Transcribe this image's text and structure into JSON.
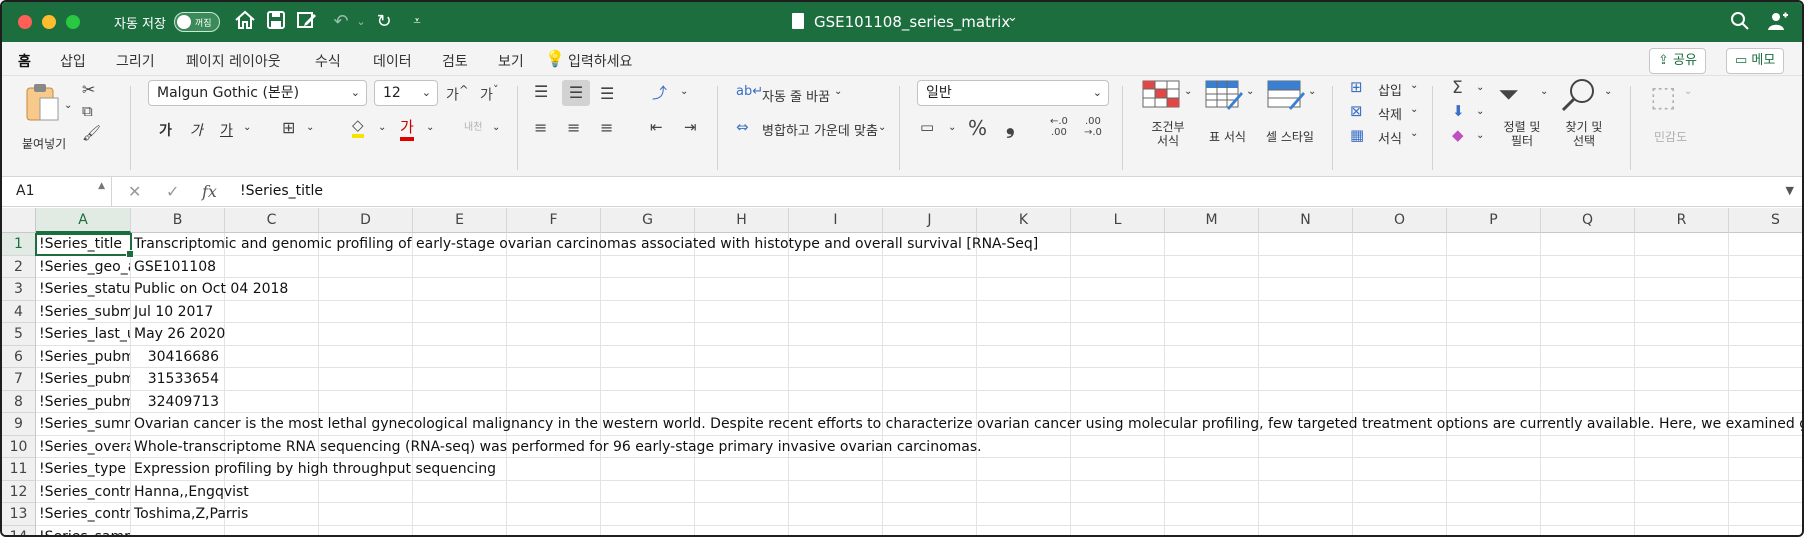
{
  "titlebar": {
    "autosave_label": "자동 저장",
    "autosave_state": "꺼짐",
    "doc_title": "GSE101108_series_matrix",
    "doc_title_caret": "⌄"
  },
  "tabs": [
    "홈",
    "삽입",
    "그리기",
    "페이지 레이아웃",
    "수식",
    "데이터",
    "검토",
    "보기"
  ],
  "tell_me": "입력하세요",
  "share_label": "공유",
  "comment_label": "메모",
  "ribbon": {
    "paste_label": "붙여넣기",
    "font_name": "Malgun Gothic (본문)",
    "font_size": "12",
    "bold": "가",
    "italic": "가",
    "underline": "가",
    "font_color_glyph": "가",
    "phonetic": "내천",
    "wrap_text": "자동 줄 바꿈",
    "merge_center": "병합하고 가운데 맞춤",
    "number_format": "일반",
    "conditional_format": "조건부 서식",
    "table_format": "표 서식",
    "cell_style": "셀 스타일",
    "insert": "삽입",
    "delete": "삭제",
    "format": "서식",
    "sort_filter": "정렬 및 필터",
    "find_select": "찾기 및 선택",
    "sensitivity": "민감도"
  },
  "formula_bar": {
    "name_box": "A1",
    "fx": "fx",
    "content": "!Series_title"
  },
  "columns": [
    "A",
    "B",
    "C",
    "D",
    "E",
    "F",
    "G",
    "H",
    "I",
    "J",
    "K",
    "L",
    "M",
    "N",
    "O",
    "P",
    "Q",
    "R",
    "S"
  ],
  "rows": [
    {
      "n": "1",
      "a": "!Series_title",
      "b": "Transcriptomic and genomic profiling of early-stage ovarian carcinomas associated with histotype and overall survival [RNA-Seq]",
      "num": false
    },
    {
      "n": "2",
      "a": "!Series_geo_accession",
      "b": "GSE101108",
      "num": false
    },
    {
      "n": "3",
      "a": "!Series_status",
      "b": "Public on Oct 04 2018",
      "num": false
    },
    {
      "n": "4",
      "a": "!Series_submission_date",
      "b": "Jul 10 2017",
      "num": false
    },
    {
      "n": "5",
      "a": "!Series_last_update_date",
      "b": "May 26 2020",
      "num": false
    },
    {
      "n": "6",
      "a": "!Series_pubmed_id",
      "b": "30416686",
      "num": true
    },
    {
      "n": "7",
      "a": "!Series_pubmed_id",
      "b": "31533654",
      "num": true
    },
    {
      "n": "8",
      "a": "!Series_pubmed_id",
      "b": "32409713",
      "num": true
    },
    {
      "n": "9",
      "a": "!Series_summary",
      "b": "Ovarian cancer is the most lethal gynecological malignancy in the western world. Despite recent efforts to characterize ovarian cancer using molecular profiling, few targeted treatment options are currently available. Here, we examined genetic variants",
      "num": false
    },
    {
      "n": "10",
      "a": "!Series_overall_design",
      "b": "Whole-transcriptome RNA sequencing (RNA-seq) was performed for 96 early-stage primary invasive ovarian carcinomas.",
      "num": false
    },
    {
      "n": "11",
      "a": "!Series_type",
      "b": "Expression profiling by high throughput sequencing",
      "num": false
    },
    {
      "n": "12",
      "a": "!Series_contributor",
      "b": "Hanna,,Engqvist",
      "num": false
    },
    {
      "n": "13",
      "a": "!Series_contributor",
      "b": "Toshima,Z,Parris",
      "num": false
    },
    {
      "n": "14",
      "a": "!Series_sample_id",
      "b": "",
      "num": false
    }
  ]
}
